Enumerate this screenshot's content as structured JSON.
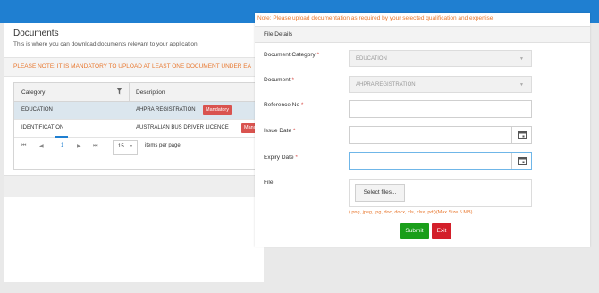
{
  "documents": {
    "title": "Documents",
    "subtitle": "This is where you can download documents relevant to your application.",
    "notice": "PLEASE NOTE: IT IS MANDATORY TO UPLOAD AT LEAST ONE DOCUMENT UNDER EA",
    "columns": [
      "Category",
      "Description"
    ],
    "rows": [
      {
        "category": "EDUCATION",
        "description": "AHPRA REGISTRATION",
        "badge": "Mandatory"
      },
      {
        "category": "IDENTIFICATION",
        "description": "AUSTRALIAN BUS DRIVER LICENCE",
        "badge": "Mand"
      }
    ],
    "pager": {
      "first": "⏮",
      "prev": "◀",
      "current_page": "1",
      "next": "▶",
      "last": "⏭",
      "page_size": "15",
      "items_per_page": "items per page"
    }
  },
  "modal": {
    "note": "Note: Please upload documentation as required by your selected qualification and expertise.",
    "section_title": "File Details",
    "fields": {
      "document_category": {
        "label": "Document Category",
        "value": "EDUCATION"
      },
      "document": {
        "label": "Document",
        "value": "AHPRA REGISTRATION"
      },
      "reference_no": {
        "label": "Reference No",
        "value": ""
      },
      "issue_date": {
        "label": "Issue Date",
        "value": ""
      },
      "expiry_date": {
        "label": "Expiry Date",
        "value": ""
      },
      "file": {
        "label": "File",
        "button": "Select files..."
      }
    },
    "required_marker": "*",
    "file_hint": "(.png,.jpeg,.jpg,.doc,.docx,.xls,.xlsx,.pdf)(Max Size 5 MB)",
    "submit_label": "Submit",
    "exit_label": "Exit"
  },
  "colors": {
    "accent": "#1f7fd1",
    "warning": "#e8772e",
    "danger": "#d9534f",
    "success": "#1a9e1a"
  }
}
